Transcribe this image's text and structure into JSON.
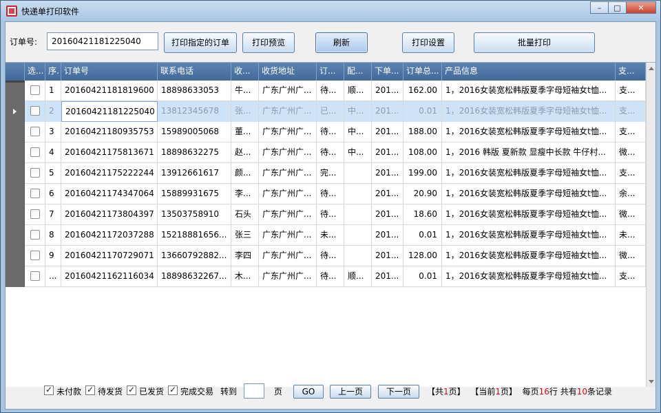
{
  "window": {
    "title": "快递单打印软件"
  },
  "toolbar": {
    "order_label": "订单号:",
    "order_value": "20160421181225040",
    "btn_print_specified": "打印指定的订单",
    "btn_print_preview": "打印预览",
    "btn_refresh": "刷新",
    "btn_print_settings": "打印设置",
    "btn_batch_print": "批量打印"
  },
  "table": {
    "headers": [
      "选...",
      "序.",
      "订单号",
      "联系电话",
      "收...",
      "收货地址",
      "订...",
      "配...",
      "下单...",
      "订单总...",
      "产品信息",
      "支..."
    ],
    "rows": [
      {
        "seq": "1",
        "order": "20160421181819600",
        "phone": "18898633053",
        "name": "牛...",
        "addr": "广东广州广...",
        "status": "待...",
        "ship": "顺...",
        "date": "201...",
        "total": "162.00",
        "product": "1，2016女装宽松韩版夏季字母短袖女t恤...",
        "pay": "支..."
      },
      {
        "seq": "2",
        "order": "20160421181225040",
        "phone": "13812345678",
        "name": "张...",
        "addr": "广东广州广...",
        "status": "已...",
        "ship": "中...",
        "date": "201...",
        "total": "0.01",
        "product": "1，2016女装宽松韩版夏季字母短袖女t恤...",
        "pay": "支..."
      },
      {
        "seq": "3",
        "order": "20160421180935753",
        "phone": "15989005068",
        "name": "董...",
        "addr": "广东广州广...",
        "status": "待...",
        "ship": "中...",
        "date": "201...",
        "total": "188.00",
        "product": "1，2016女装宽松韩版夏季字母短袖女t恤...",
        "pay": "支..."
      },
      {
        "seq": "4",
        "order": "20160421175813671",
        "phone": "18898632275",
        "name": "赵...",
        "addr": "广东广州广...",
        "status": "待...",
        "ship": "中...",
        "date": "201...",
        "total": "108.00",
        "product": "1，2016 韩版 夏新款 显瘦中长款 牛仔村...",
        "pay": "微..."
      },
      {
        "seq": "5",
        "order": "20160421175222244",
        "phone": "13912661617",
        "name": "颜...",
        "addr": "广东广州广...",
        "status": "完...",
        "ship": "",
        "date": "201...",
        "total": "199.00",
        "product": "1，2016女装宽松韩版夏季字母短袖女t恤...",
        "pay": "支..."
      },
      {
        "seq": "6",
        "order": "20160421174347064",
        "phone": "15889931675",
        "name": "李...",
        "addr": "广东广州广...",
        "status": "待...",
        "ship": "",
        "date": "201...",
        "total": "20.90",
        "product": "1，2016女装宽松韩版夏季字母短袖女t恤...",
        "pay": "余..."
      },
      {
        "seq": "7",
        "order": "20160421173804397",
        "phone": "13503758910",
        "name": "石头",
        "addr": "广东广州广...",
        "status": "待...",
        "ship": "",
        "date": "201...",
        "total": "18.60",
        "product": "1，2016女装宽松韩版夏季字母短袖女t恤...",
        "pay": "微..."
      },
      {
        "seq": "8",
        "order": "20160421172037288",
        "phone": "15218881656...",
        "name": "张三",
        "addr": "广东广州广...",
        "status": "未...",
        "ship": "",
        "date": "201...",
        "total": "0.01",
        "product": "1，2016女装宽松韩版夏季字母短袖女t恤...",
        "pay": "未..."
      },
      {
        "seq": "9",
        "order": "20160421170729071",
        "phone": "13660792882...",
        "name": "李四",
        "addr": "广东广州广...",
        "status": "待...",
        "ship": "",
        "date": "201...",
        "total": "128.00",
        "product": "1，2016女装宽松韩版夏季字母短袖女t恤...",
        "pay": "微..."
      },
      {
        "seq": "...",
        "order": "20160421162116034",
        "phone": "18898632267...",
        "name": "木...",
        "addr": "广东广州广...",
        "status": "待...",
        "ship": "顺...",
        "date": "201...",
        "total": "0.01",
        "product": "1，2016女装宽松韩版夏季字母短袖女t恤...",
        "pay": "支..."
      }
    ]
  },
  "footer": {
    "filter_unpaid": "未付款",
    "filter_pending": "待发货",
    "filter_shipped": "已发货",
    "filter_done": "完成交易",
    "goto_label": "转到",
    "page_unit": "页",
    "btn_go": "GO",
    "btn_prev": "上一页",
    "btn_next": "下一页",
    "total_pages_prefix": "【共",
    "total_pages": "1",
    "total_pages_suffix": "页】",
    "current_prefix": "【当前",
    "current_page": "1",
    "current_suffix": "页】",
    "per_page_prefix": "每页",
    "per_page": "16",
    "per_page_mid": "行 共有",
    "total_records": "10",
    "per_page_suffix": "条记录"
  }
}
